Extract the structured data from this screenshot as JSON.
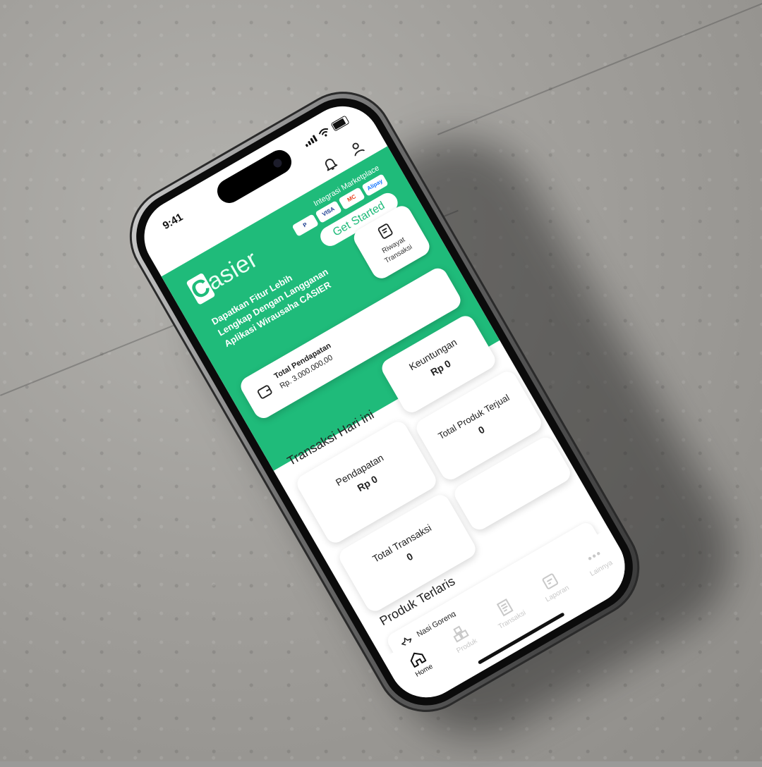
{
  "status": {
    "time": "9:41"
  },
  "header": {
    "logo": "asier",
    "logo_initial": "C",
    "marketplace_label": "Integrasi Marketplace",
    "payment_logos": [
      "P",
      "VISA",
      "MC",
      "Alipay"
    ],
    "get_started": "Get Started",
    "tagline": "Dapatkan Fitur Lebih Lengkap Dengan Langganan Aplikasi Wirausaha CASIER"
  },
  "riwayat": {
    "line1": "Riwayat",
    "line2": "Transaksi"
  },
  "total_pendapatan": {
    "label": "Total Pendapatan",
    "value": "Rp. 3.000.000,00"
  },
  "today": {
    "title": "Transaksi Hari ini",
    "stats": [
      {
        "label": "Keuntungan",
        "value": "Rp 0"
      },
      {
        "label": "Pendapatan",
        "value": "Rp 0"
      },
      {
        "label": "Total Produk Terjual",
        "value": "0"
      },
      {
        "label": "Total Transaksi",
        "value": "0"
      }
    ]
  },
  "best_seller": {
    "title": "Produk Terlaris",
    "items": [
      {
        "name": "Nasi Goreng"
      }
    ]
  },
  "tabs": [
    {
      "name": "Home",
      "active": true
    },
    {
      "name": "Produk",
      "active": false
    },
    {
      "name": "Transaksi",
      "active": false
    },
    {
      "name": "Laporan",
      "active": false
    },
    {
      "name": "Lainnya",
      "active": false
    }
  ],
  "colors": {
    "brand_green": "#1fbb7a",
    "inactive_tab": "#c8c8c8"
  }
}
